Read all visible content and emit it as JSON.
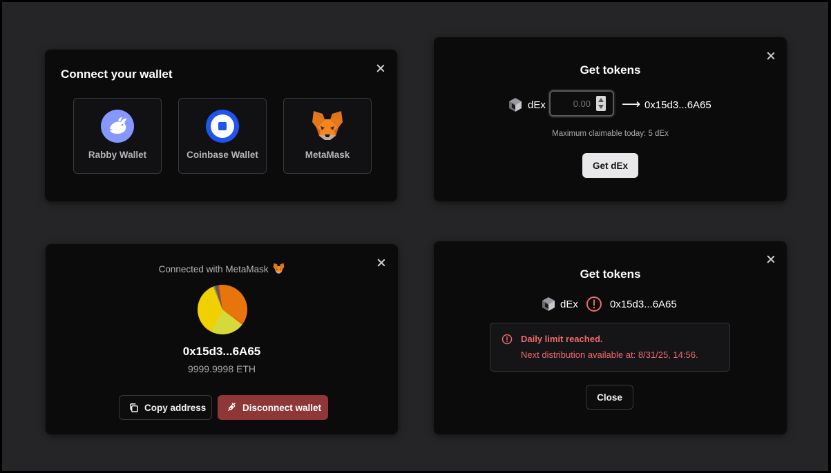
{
  "connect_card": {
    "title": "Connect your wallet",
    "wallets": [
      {
        "label": "Rabby Wallet",
        "icon": "rabby-icon"
      },
      {
        "label": "Coinbase Wallet",
        "icon": "coinbase-icon"
      },
      {
        "label": "MetaMask",
        "icon": "metamask-fox-icon"
      }
    ]
  },
  "get_tokens_card": {
    "title": "Get tokens",
    "token_symbol": "dEx",
    "amount_placeholder": "0.00",
    "arrow": "⟶",
    "recipient": "0x15d3...6A65",
    "helper_text": "Maximum claimable today: 5 dEx",
    "submit_label": "Get dEx"
  },
  "connected_card": {
    "connected_text": "Connected with MetaMask",
    "address": "0x15d3...6A65",
    "balance": "9999.9998 ETH",
    "copy_label": "Copy address",
    "disconnect_label": "Disconnect wallet"
  },
  "error_card": {
    "title": "Get tokens",
    "token_symbol": "dEx",
    "recipient": "0x15d3...6A65",
    "alert_title": "Daily limit reached.",
    "alert_message": "Next distribution available at: 8/31/25, 14:56.",
    "close_label": "Close"
  },
  "colors": {
    "background": "#252527",
    "card": "#0b0b0c",
    "error": "#f06a6a",
    "danger_button": "#8f3737"
  }
}
